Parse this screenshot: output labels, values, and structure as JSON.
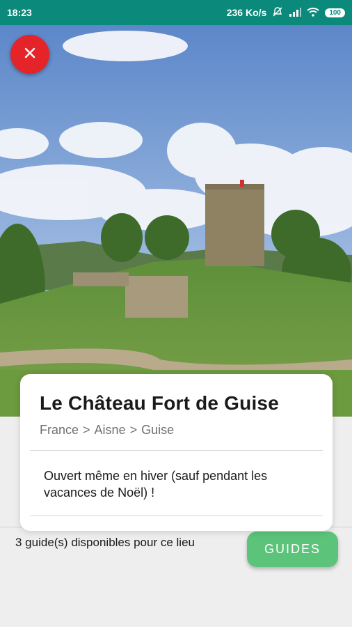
{
  "status_bar": {
    "time": "18:23",
    "network_speed": "236 Ko/s",
    "battery": "100",
    "icons": [
      "bell-off-icon",
      "signal-icon",
      "wifi-icon",
      "battery-icon"
    ],
    "background_color": "#0b8a7b"
  },
  "hero": {
    "image": "castle-tower-photo",
    "close_icon": "close-icon",
    "close_button_color": "#e5242a"
  },
  "place": {
    "title": "Le Château Fort de Guise",
    "breadcrumb": [
      "France",
      ">",
      "Aisne",
      ">",
      "Guise"
    ],
    "description": "Ouvert même en hiver (sauf pendant les vacances de Noël) !"
  },
  "bottom": {
    "guides_available": "3 guide(s) disponibles pour ce lieu",
    "guides_button_label": "GUIDES",
    "guides_button_color": "#5cc47a"
  }
}
